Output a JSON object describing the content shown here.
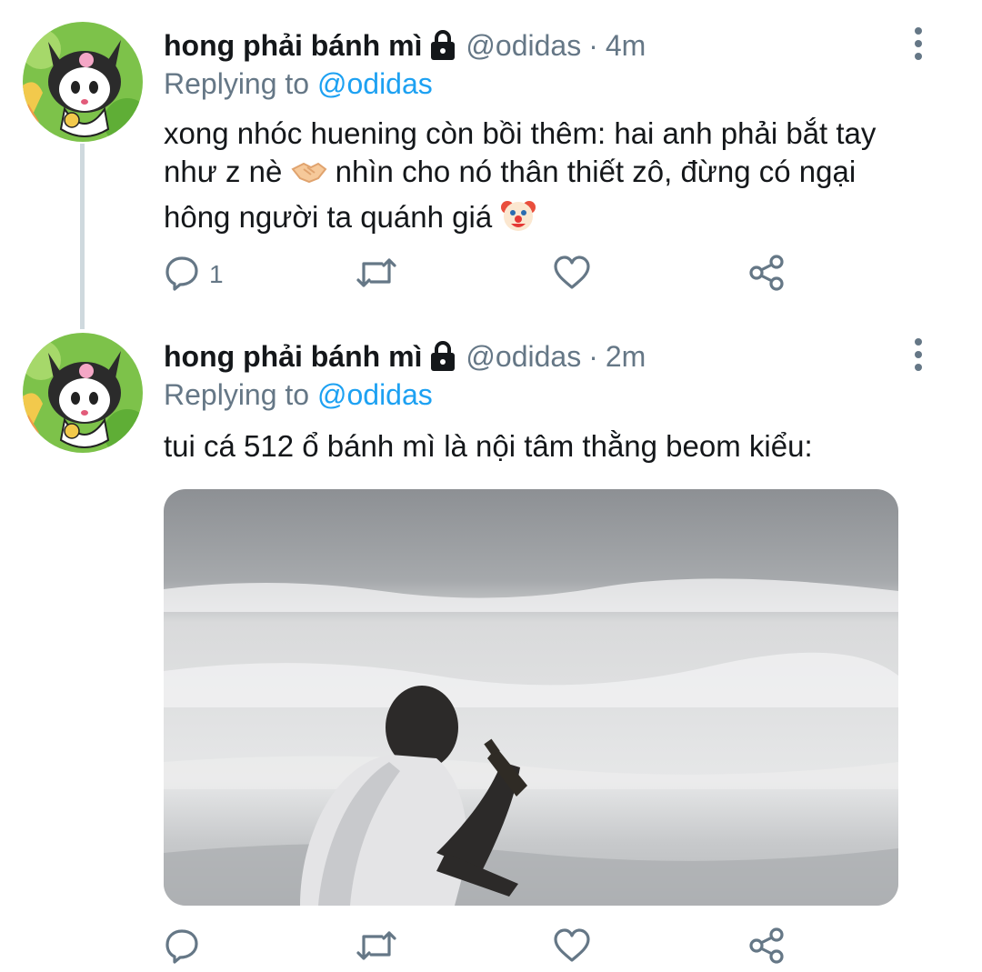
{
  "tweets": [
    {
      "name": "hong phải bánh mì",
      "handle": "@odidas",
      "separator": "·",
      "time": "4m",
      "replying_prefix": "Replying to",
      "replying_to": "@odidas",
      "text_parts": [
        "xong nhóc huening còn bồi thêm: hai anh phải bắt tay như z nè ",
        " nhìn cho nó thân thiết zô, đừng có ngại hông người ta quánh giá "
      ],
      "icons": [
        "lock-icon",
        "handshake-emoji",
        "clown-face-emoji"
      ],
      "reply_count": "1"
    },
    {
      "name": "hong phải bánh mì",
      "handle": "@odidas",
      "separator": "·",
      "time": "2m",
      "replying_prefix": "Replying to",
      "replying_to": "@odidas",
      "text": "tui cá 512 ổ bánh mì là nội tâm thằng beom kiểu:",
      "icons": [
        "lock-icon"
      ],
      "media": "photo of a man sitting in ocean waves holding a bottle",
      "reply_count": ""
    }
  ],
  "action_icons": [
    "reply-icon",
    "retweet-icon",
    "like-icon",
    "share-icon",
    "more-options-icon"
  ],
  "colors": {
    "link": "#1da1f2",
    "muted": "#657786",
    "text": "#14171a",
    "thread_line": "#cfd9de"
  }
}
